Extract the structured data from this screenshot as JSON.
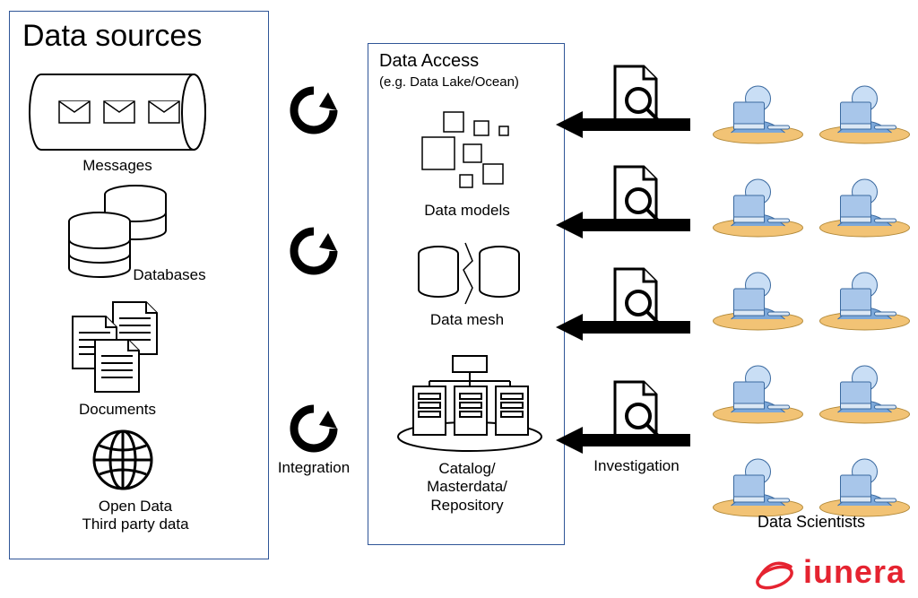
{
  "sources": {
    "heading": "Data sources",
    "messages_label": "Messages",
    "databases_label": "Databases",
    "documents_label": "Documents",
    "opendata_label1": "Open Data",
    "opendata_label2": "Third party data"
  },
  "integration": {
    "label": "Integration"
  },
  "access": {
    "heading": "Data Access",
    "subtitle": "(e.g. Data Lake/Ocean)",
    "models_label": "Data models",
    "mesh_label": "Data mesh",
    "catalog_label1": "Catalog/",
    "catalog_label2": "Masterdata/",
    "catalog_label3": "Repository"
  },
  "investigation": {
    "label": "Investigation"
  },
  "scientists": {
    "label": "Data Scientists"
  },
  "brand": {
    "name": "iunera"
  }
}
